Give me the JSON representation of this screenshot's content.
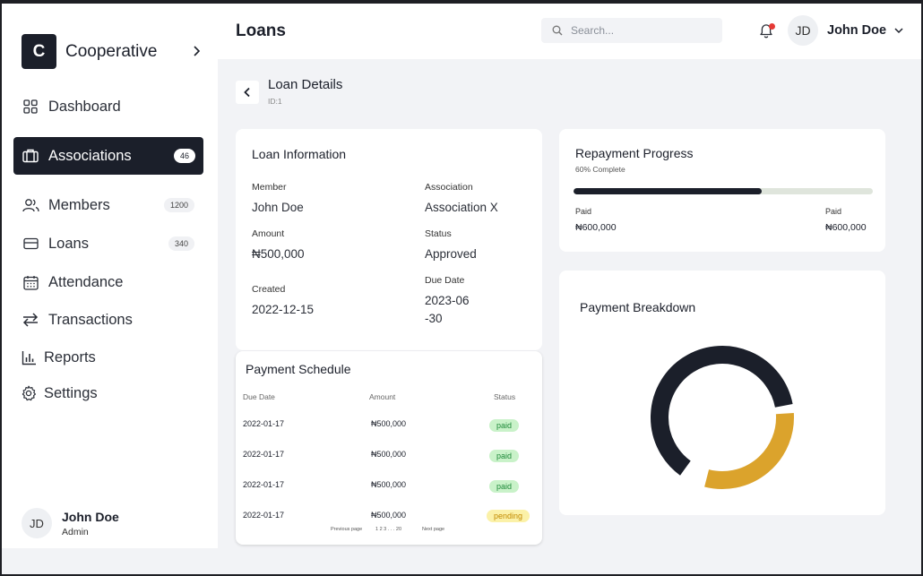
{
  "sidebar": {
    "brand": {
      "initial": "C",
      "name": "Cooperative"
    },
    "items": [
      {
        "label": "Dashboard",
        "icon": "grid-icon",
        "badge": ""
      },
      {
        "label": "Associations",
        "icon": "briefcase-icon",
        "badge": "46"
      },
      {
        "label": "Members",
        "icon": "users-icon",
        "badge": "1200"
      },
      {
        "label": "Loans",
        "icon": "card-icon",
        "badge": "340"
      },
      {
        "label": "Attendance",
        "icon": "calendar-icon",
        "badge": ""
      },
      {
        "label": "Transactions",
        "icon": "transfer-icon",
        "badge": ""
      },
      {
        "label": "Reports",
        "icon": "bar-chart-icon",
        "badge": ""
      },
      {
        "label": "Settings",
        "icon": "gear-icon",
        "badge": ""
      }
    ],
    "active_index": 1,
    "user": {
      "initials": "JD",
      "name": "John Doe",
      "role": "Admin"
    }
  },
  "header": {
    "title": "Loans",
    "search_placeholder": "Search...",
    "user": {
      "initials": "JD",
      "name": "John Doe"
    },
    "notification_color": "#e53935"
  },
  "page": {
    "title": "Loan Details",
    "id_label": "ID:1"
  },
  "loan_info": {
    "title": "Loan Information",
    "fields": [
      {
        "label": "Member",
        "value": "John Doe"
      },
      {
        "label": "Association",
        "value": "Association X"
      },
      {
        "label": "Amount",
        "value": "₦500,000"
      },
      {
        "label": "Status",
        "value": "Approved"
      },
      {
        "label": "Created",
        "value": "2022-12-15"
      },
      {
        "label": "Due Date",
        "value": "2023-06\n-30"
      }
    ]
  },
  "schedule": {
    "title": "Payment Schedule",
    "columns": [
      "Due Date",
      "Amount",
      "Status"
    ],
    "rows": [
      {
        "date": "2022-01-17",
        "amount": "₦500,000",
        "status": "paid"
      },
      {
        "date": "2022-01-17",
        "amount": "₦500,000",
        "status": "paid"
      },
      {
        "date": "2022-01-17",
        "amount": "₦500,000",
        "status": "paid"
      },
      {
        "date": "2022-01-17",
        "amount": "₦500,000",
        "status": "pending"
      }
    ],
    "pager": {
      "prev": "Previous page",
      "pages": "1 2 3 . . . 20",
      "next": "Next page"
    }
  },
  "repayment": {
    "title": "Repayment Progress",
    "subtitle": "60% Complete",
    "progress_percent": 63,
    "left": {
      "label": "Paid",
      "value": "₦600,000"
    },
    "right": {
      "label": "Paid",
      "value": "₦600,000"
    }
  },
  "breakdown": {
    "title": "Payment Breakdown",
    "segments": [
      {
        "name": "",
        "share": 0.64,
        "color": "#1b1f2a"
      },
      {
        "name": "",
        "share": 0.32,
        "color": "#dba32c"
      }
    ]
  },
  "colors": {
    "accent": "#1b1f2a",
    "paid": "#c9f2c9",
    "pending": "#fbf1a8",
    "gold": "#dba32c"
  }
}
